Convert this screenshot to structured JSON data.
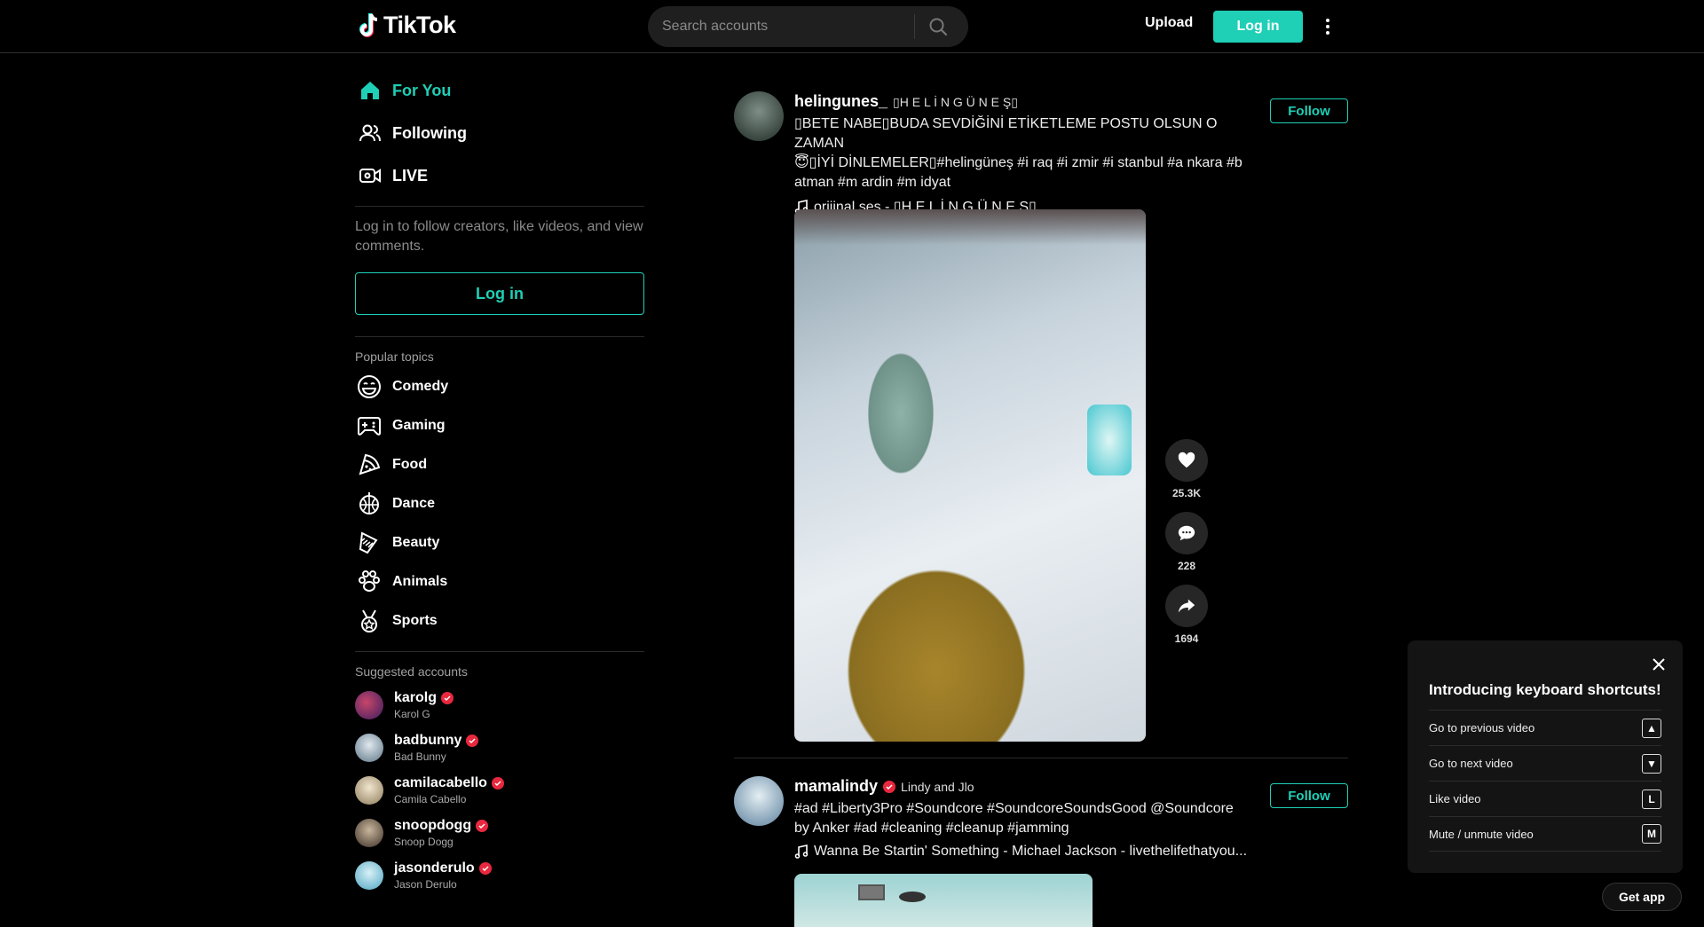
{
  "header": {
    "logo_text": "TikTok",
    "search_placeholder": "Search accounts",
    "upload_label": "Upload",
    "login_label": "Log in"
  },
  "sidebar": {
    "nav": [
      {
        "label": "For You",
        "icon": "home-icon",
        "active": true
      },
      {
        "label": "Following",
        "icon": "following-icon",
        "active": false
      },
      {
        "label": "LIVE",
        "icon": "live-icon",
        "active": false
      }
    ],
    "login_hint": "Log in to follow creators, like videos, and view comments.",
    "login_label": "Log in",
    "popular_topics_title": "Popular topics",
    "topics": [
      {
        "label": "Comedy",
        "icon": "comedy-icon"
      },
      {
        "label": "Gaming",
        "icon": "gaming-icon"
      },
      {
        "label": "Food",
        "icon": "food-icon"
      },
      {
        "label": "Dance",
        "icon": "dance-icon"
      },
      {
        "label": "Beauty",
        "icon": "beauty-icon"
      },
      {
        "label": "Animals",
        "icon": "animals-icon"
      },
      {
        "label": "Sports",
        "icon": "sports-icon"
      }
    ],
    "suggested_title": "Suggested accounts",
    "accounts": [
      {
        "handle": "karolg",
        "name": "Karol G",
        "color": "#5a2d7a"
      },
      {
        "handle": "badbunny",
        "name": "Bad Bunny",
        "color": "#8aa0b0"
      },
      {
        "handle": "camilacabello",
        "name": "Camila Cabello",
        "color": "#c4b89a"
      },
      {
        "handle": "snoopdogg",
        "name": "Snoop Dogg",
        "color": "#6b5a4a"
      },
      {
        "handle": "jasonderulo",
        "name": "Jason Derulo",
        "color": "#8ec6d8"
      }
    ]
  },
  "posts": [
    {
      "username": "helingunes_",
      "nickname": "▯H E L İ N G Ü N E Ş▯",
      "description_lines": [
        "▯BETE NABE▯BUDA SEVDİĞİNİ ETİKETLEME POSTU OLSUN O ZAMAN",
        "😇▯İYİ DİNLEMELER▯#helingüneş #i raq #i zmir #i stanbul #a nkara #b",
        "atman #m ardin #m idyat"
      ],
      "music": "orijinal ses - ▯H E L İ N G Ü N E Ş▯",
      "follow_label": "Follow",
      "likes": "25.3K",
      "comments": "228",
      "shares": "1694"
    },
    {
      "username": "mamalindy",
      "nickname": "Lindy and Jlo",
      "description_lines": [
        "#ad #Liberty3Pro #Soundcore #SoundcoreSoundsGood @Soundcore",
        "by Anker #ad #cleaning #cleanup #jamming"
      ],
      "music": "Wanna Be Startin' Something - Michael Jackson - livethelifethatyou...",
      "follow_label": "Follow"
    }
  ],
  "keyboard_popup": {
    "title": "Introducing keyboard shortcuts!",
    "shortcuts": [
      {
        "label": "Go to previous video",
        "key": "▲"
      },
      {
        "label": "Go to next video",
        "key": "▼"
      },
      {
        "label": "Like video",
        "key": "L"
      },
      {
        "label": "Mute / unmute video",
        "key": "M"
      }
    ]
  },
  "get_app_label": "Get app",
  "colors": {
    "accent": "#1fcfb6",
    "verified": "#e8283e",
    "background": "#000000"
  }
}
